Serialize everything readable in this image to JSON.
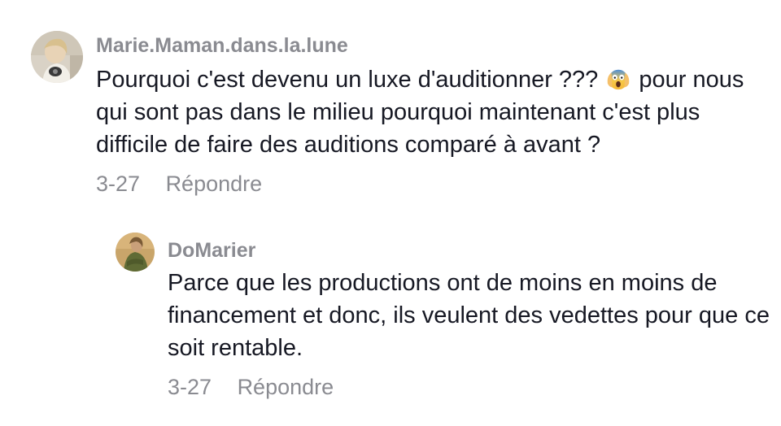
{
  "comments": [
    {
      "username": "Marie.Maman.dans.la.lune",
      "text_before_emoji": "Pourquoi c'est devenu un luxe d'auditionner ??? ",
      "emoji": "face-screaming-in-fear-icon",
      "text_after_emoji": " pour nous qui sont pas dans le milieu pourquoi maintenant c'est plus difficile de faire des auditions comparé à avant ?",
      "date": "3-27",
      "reply_label": "Répondre"
    },
    {
      "username": "DoMarier",
      "text": "Parce que les productions ont de moins en moins de financement et donc, ils veulent des vedettes pour que ce soit rentable.",
      "date": "3-27",
      "reply_label": "Répondre"
    }
  ],
  "colors": {
    "username": "#8a8b91",
    "text": "#161823",
    "meta": "#8a8b91"
  }
}
